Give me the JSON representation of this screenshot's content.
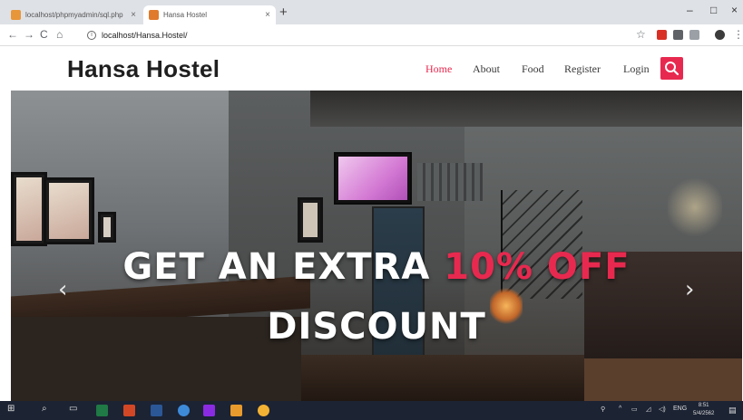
{
  "browser": {
    "tabs": [
      {
        "title": "localhost/phpmyadmin/sql.php",
        "close": "×"
      },
      {
        "title": "Hansa Hostel",
        "close": "×"
      }
    ],
    "new_tab_label": "+",
    "url": "localhost/Hansa.Hostel/",
    "window_controls": {
      "minimize": "–",
      "maximize": "□",
      "close": "×"
    },
    "nav": {
      "back": "←",
      "forward": "→",
      "reload": "C",
      "home": "⌂"
    }
  },
  "site": {
    "brand": "Hansa Hostel",
    "menu": [
      "Home",
      "About",
      "Food",
      "Register",
      "Login"
    ],
    "active_menu": "Home",
    "accent_color": "#e8294f"
  },
  "hero": {
    "line1_part1": "GET AN EXTRA",
    "line1_part2": "10% OFF",
    "line2": "DISCOUNT",
    "prev_arrow": "‹",
    "next_arrow": "›"
  },
  "taskbar": {
    "tray_lang": "ENG",
    "time": "8:51",
    "date": "5/4/2562"
  }
}
